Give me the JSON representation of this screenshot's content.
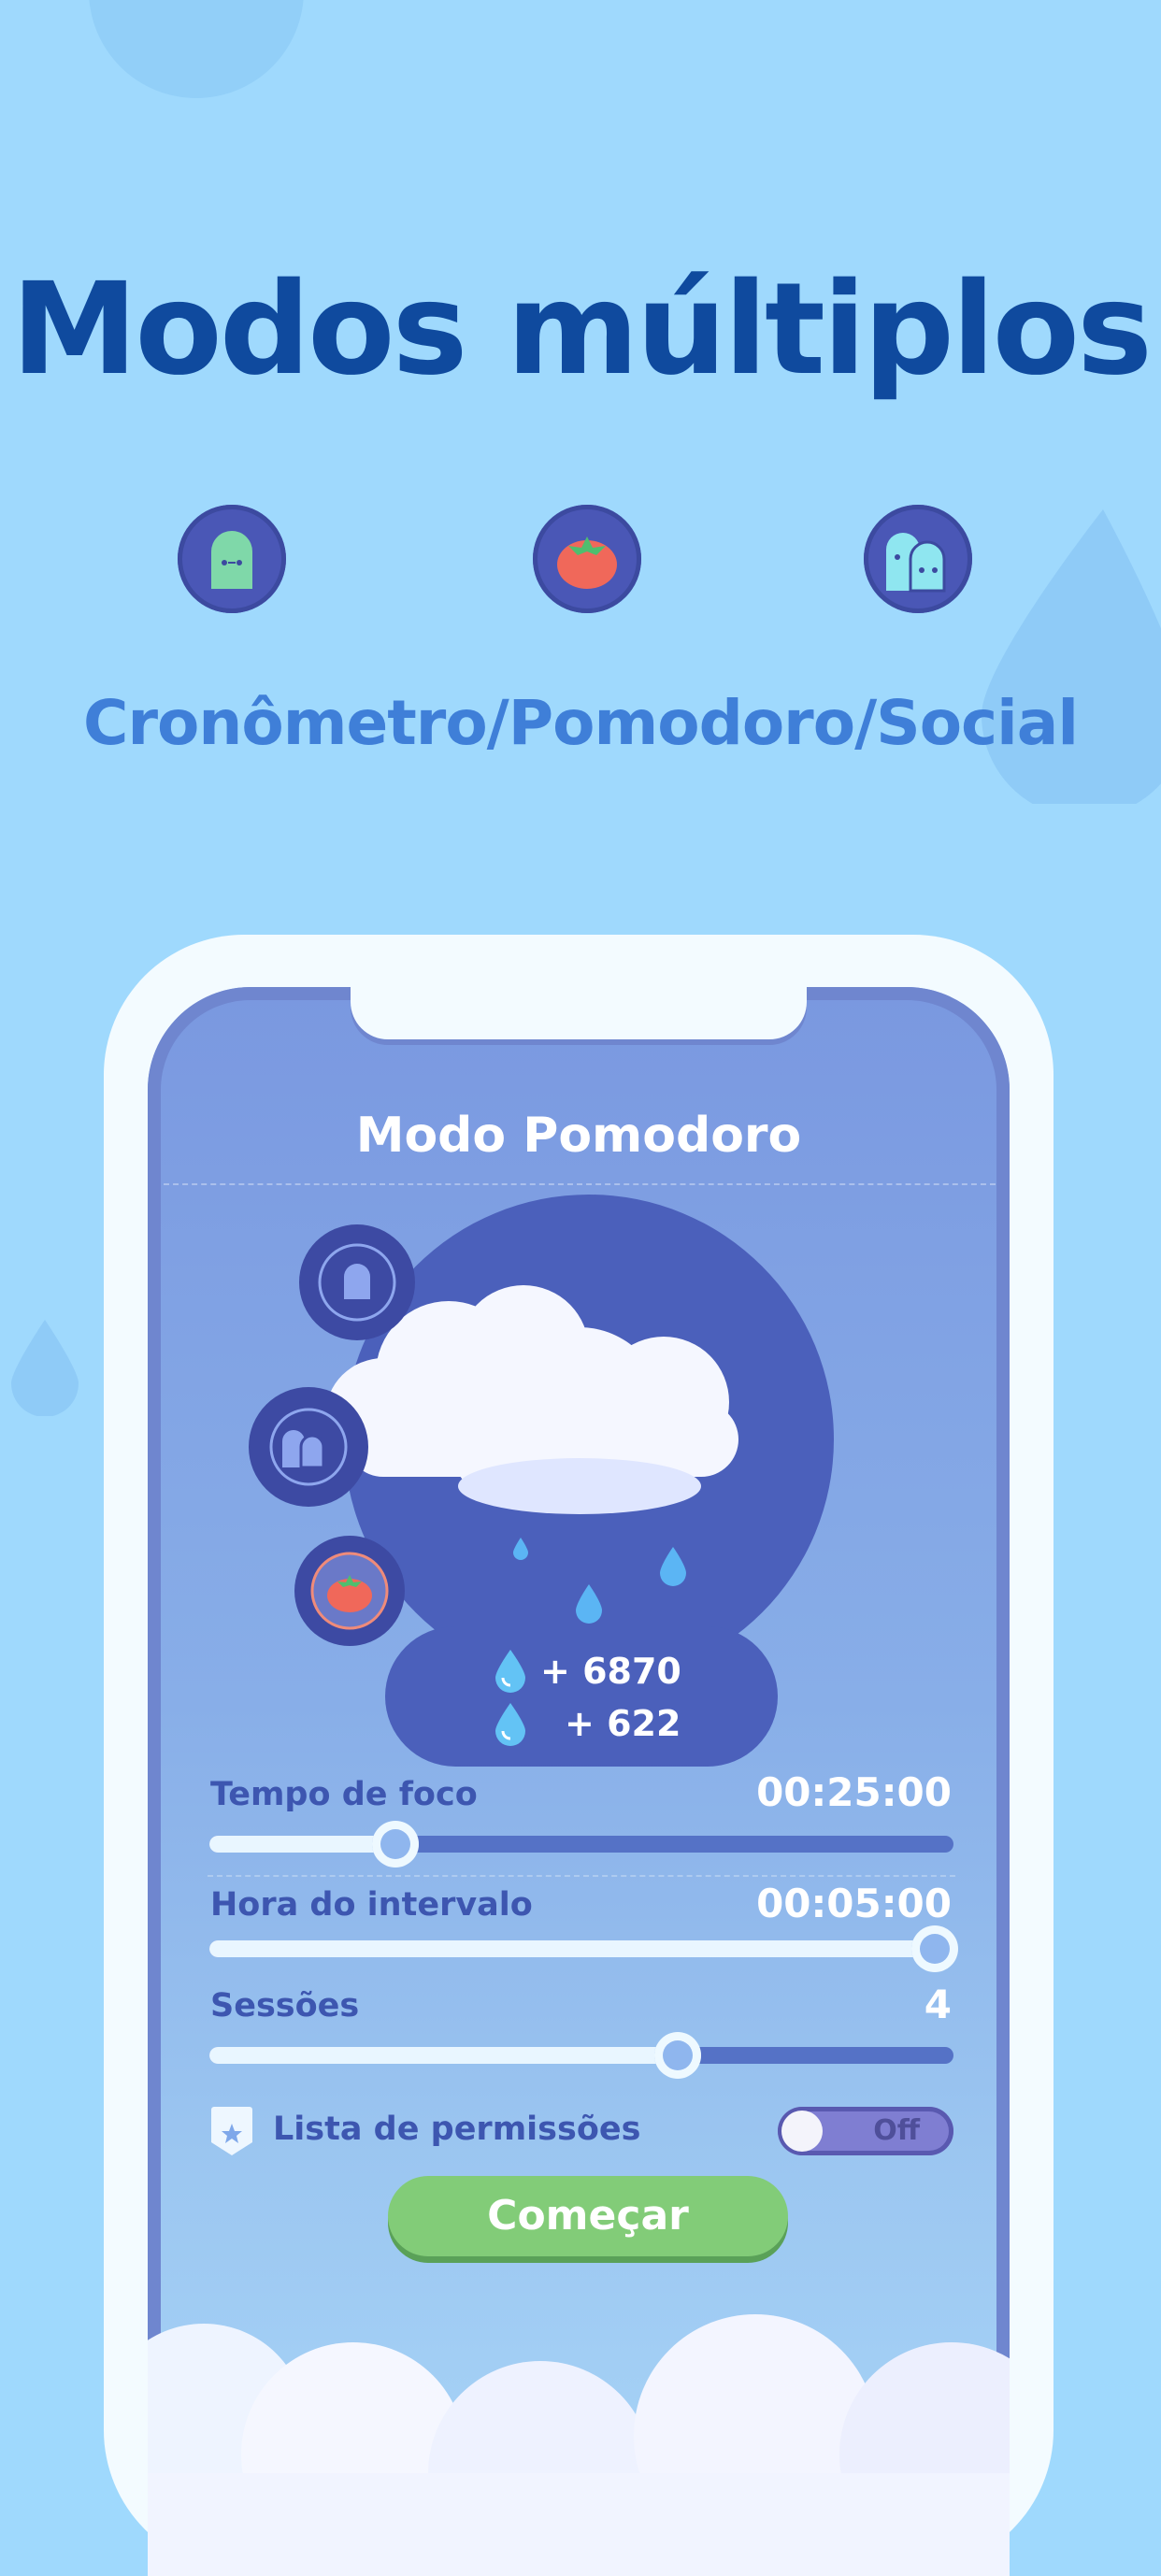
{
  "headline": "Modos múltiplos",
  "modes": [
    {
      "icon": "stopwatch-ghost-icon"
    },
    {
      "icon": "tomato-icon"
    },
    {
      "icon": "social-ghosts-icon"
    }
  ],
  "subtitle": "Cronômetro/Pomodoro/Social",
  "screen": {
    "title": "Modo Pomodoro",
    "rewards": [
      {
        "icon": "water-drop-icon",
        "text": "+ 6870"
      },
      {
        "icon": "water-drop-icon",
        "text": "+ 622"
      }
    ],
    "settings": {
      "focus": {
        "label": "Tempo de foco",
        "value": "00:25:00",
        "level": 0.25
      },
      "break": {
        "label": "Hora do intervalo",
        "value": "00:05:00",
        "level": 1.0
      },
      "sessions": {
        "label": "Sessões",
        "value": "4",
        "level": 0.63
      }
    },
    "allowlist": {
      "label": "Lista de permissões",
      "toggle": "Off",
      "icon": "shield-star-icon"
    },
    "start_button": "Começar"
  },
  "colors": {
    "background": "#9fd9fd",
    "headline": "#0f4a9e",
    "subtitle": "#3f7fd8",
    "accent_purple": "#4a57b6",
    "button_green": "#82cc78"
  }
}
